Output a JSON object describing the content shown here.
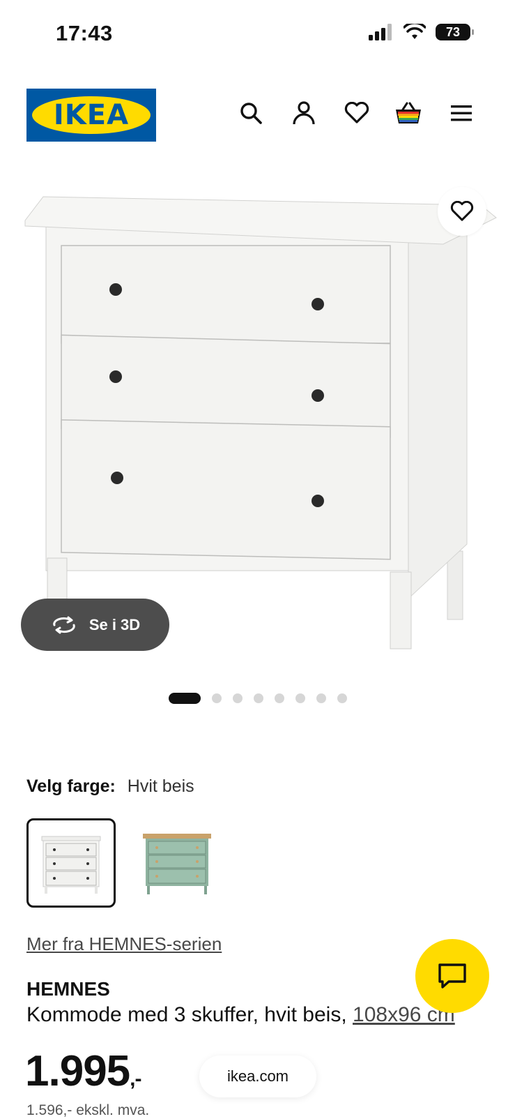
{
  "status_bar": {
    "time": "17:43",
    "battery": "73"
  },
  "header": {
    "logo_text": "IKEA"
  },
  "product_image": {
    "see_3d_label": "Se i 3D",
    "dots_total": 8,
    "dots_active_index": 0
  },
  "color": {
    "label": "Velg farge:",
    "value": "Hvit beis",
    "swatches": [
      {
        "name": "Hvit beis",
        "selected": true
      },
      {
        "name": "green",
        "selected": false
      }
    ]
  },
  "series_link": "Mer fra HEMNES-serien",
  "product": {
    "name": "HEMNES",
    "description": "Kommode med 3 skuffer, hvit beis, ",
    "measure": "108x96 cm",
    "price": "1.995",
    "price_suffix": ",-",
    "price_excl": "1.596,- ekskl. mva."
  },
  "browser": {
    "url": "ikea.com"
  },
  "colors": {
    "ikea_blue": "#0058a3",
    "ikea_yellow": "#ffdb00",
    "button_dark": "#4d4d4d"
  }
}
